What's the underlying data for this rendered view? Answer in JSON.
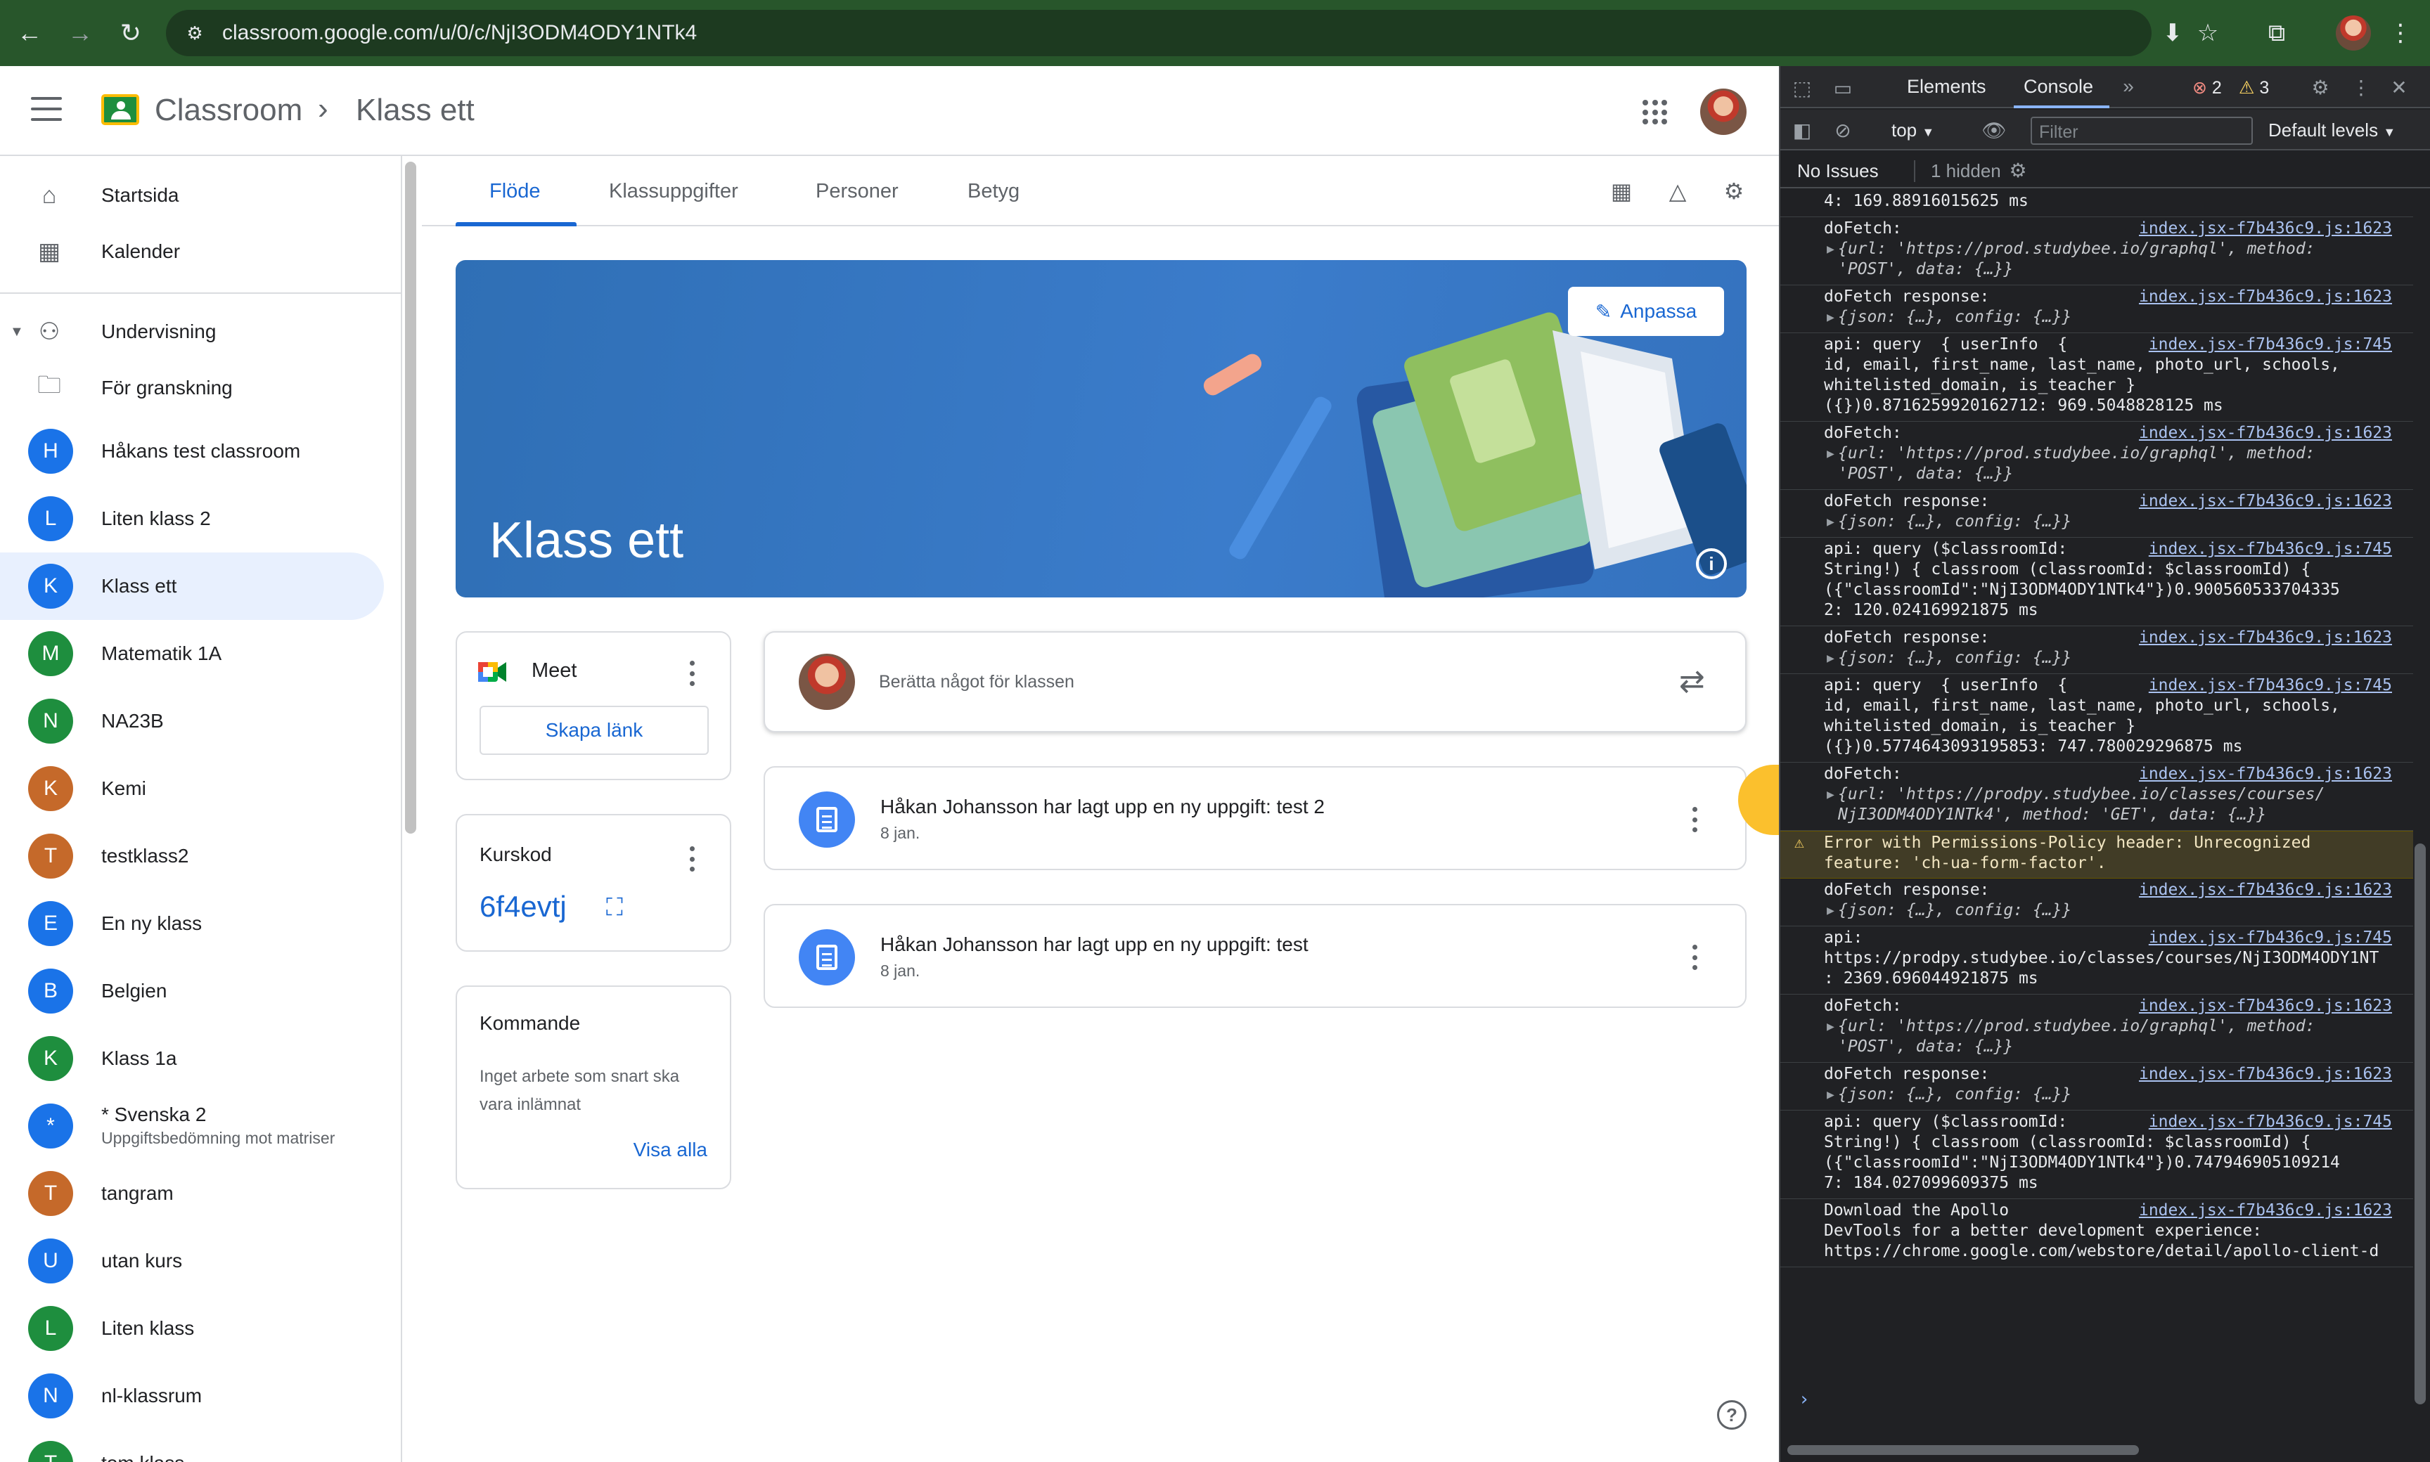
{
  "browser": {
    "url": "classroom.google.com/u/0/c/NjI3ODM4ODY1NTk4",
    "icons": [
      "back-icon",
      "forward-icon",
      "reload-icon",
      "tune-icon",
      "install-icon",
      "star-icon",
      "extensions-icon",
      "avatar",
      "more-icon"
    ]
  },
  "header": {
    "brand": "Classroom",
    "separator": "›",
    "crumb": "Klass ett"
  },
  "sidebar": {
    "home": "Startsida",
    "calendar": "Kalender",
    "teaching": "Undervisning",
    "review": "För granskning",
    "classes": [
      {
        "initial": "H",
        "label": "Håkans test classroom",
        "color": "#1a73e8"
      },
      {
        "initial": "L",
        "label": "Liten klass 2",
        "color": "#1a73e8"
      },
      {
        "initial": "K",
        "label": "Klass ett",
        "color": "#1a73e8",
        "selected": true
      },
      {
        "initial": "M",
        "label": "Matematik 1A",
        "color": "#1e8e3e"
      },
      {
        "initial": "N",
        "label": "NA23B",
        "color": "#1e8e3e"
      },
      {
        "initial": "K",
        "label": "Kemi",
        "color": "#c5692a"
      },
      {
        "initial": "T",
        "label": "testklass2",
        "color": "#c5692a"
      },
      {
        "initial": "E",
        "label": "En ny klass",
        "color": "#1a73e8"
      },
      {
        "initial": "B",
        "label": "Belgien",
        "color": "#1a73e8"
      },
      {
        "initial": "K",
        "label": "Klass 1a",
        "color": "#1e8e3e"
      },
      {
        "initial": "*",
        "label": "* Svenska 2",
        "sub": "Uppgiftsbedömning mot matriser",
        "color": "#1a73e8"
      },
      {
        "initial": "T",
        "label": "tangram",
        "color": "#c5692a"
      },
      {
        "initial": "U",
        "label": "utan kurs",
        "color": "#1a73e8"
      },
      {
        "initial": "L",
        "label": "Liten klass",
        "color": "#1e8e3e"
      },
      {
        "initial": "N",
        "label": "nl-klassrum",
        "color": "#1a73e8"
      },
      {
        "initial": "T",
        "label": "tom klass",
        "color": "#1e8e3e"
      }
    ]
  },
  "tabs": [
    "Flöde",
    "Klassuppgifter",
    "Personer",
    "Betyg"
  ],
  "banner": {
    "title": "Klass ett",
    "customize": "Anpassa"
  },
  "meet": {
    "title": "Meet",
    "create_link": "Skapa länk"
  },
  "course_code": {
    "title": "Kurskod",
    "code": "6f4evtj"
  },
  "upcoming": {
    "title": "Kommande",
    "text": "Inget arbete som snart ska\nvara inlämnat",
    "view_all": "Visa alla"
  },
  "compose": {
    "placeholder": "Berätta något för klassen"
  },
  "posts": [
    {
      "title": "Håkan Johansson har lagt upp en ny uppgift: test 2",
      "date": "8 jan."
    },
    {
      "title": "Håkan Johansson har lagt upp en ny uppgift: test",
      "date": "8 jan."
    }
  ],
  "devtools": {
    "tabs": [
      "Elements",
      "Console"
    ],
    "errors": "2",
    "warnings": "3",
    "context": "top",
    "filter_placeholder": "Filter",
    "levels": "Default levels",
    "no_issues": "No Issues",
    "hidden": "1 hidden",
    "logs": [
      {
        "text": "4: 169.88916015625 ms",
        "src": ""
      },
      {
        "text": "doFetch:",
        "src": "index.jsx-f7b436c9.js:1623",
        "obj": "{url: 'https://prod.studybee.io/graphql', method:\n'POST', data: {…}}"
      },
      {
        "text": "doFetch response:",
        "src": "index.jsx-f7b436c9.js:1623",
        "obj": "{json: {…}, config: {…}}"
      },
      {
        "text": "api: query  { userInfo  {\nid, email, first_name, last_name, photo_url, schools,\nwhitelisted_domain, is_teacher }\n({})0.8716259920162712: 969.5048828125 ms",
        "src": "index.jsx-f7b436c9.js:745"
      },
      {
        "text": "doFetch:",
        "src": "index.jsx-f7b436c9.js:1623",
        "obj": "{url: 'https://prod.studybee.io/graphql', method:\n'POST', data: {…}}"
      },
      {
        "text": "doFetch response:",
        "src": "index.jsx-f7b436c9.js:1623",
        "obj": "{json: {…}, config: {…}}"
      },
      {
        "text": "api: query ($classroomId:\nString!) { classroom (classroomId: $classroomId) {\n({\"classroomId\":\"NjI3ODM4ODY1NTk4\"})0.900560533704335\n2: 120.024169921875 ms",
        "src": "index.jsx-f7b436c9.js:745"
      },
      {
        "text": "doFetch response:",
        "src": "index.jsx-f7b436c9.js:1623",
        "obj": "{json: {…}, config: {…}}"
      },
      {
        "text": "api: query  { userInfo  {\nid, email, first_name, last_name, photo_url, schools,\nwhitelisted_domain, is_teacher }\n({})0.5774643093195853: 747.780029296875 ms",
        "src": "index.jsx-f7b436c9.js:745"
      },
      {
        "text": "doFetch:",
        "src": "index.jsx-f7b436c9.js:1623",
        "obj": "{url: 'https://prodpy.studybee.io/classes/courses/\nNjI3ODM4ODY1NTk4', method: 'GET', data: {…}}"
      },
      {
        "text": "Error with Permissions-Policy header: Unrecognized\nfeature: 'ch-ua-form-factor'.",
        "src": "",
        "warn": true
      },
      {
        "text": "doFetch response:",
        "src": "index.jsx-f7b436c9.js:1623",
        "obj": "{json: {…}, config: {…}}"
      },
      {
        "text": "api:\nhttps://prodpy.studybee.io/classes/courses/NjI3ODM4ODY1NT\n: 2369.696044921875 ms",
        "src": "index.jsx-f7b436c9.js:745"
      },
      {
        "text": "doFetch:",
        "src": "index.jsx-f7b436c9.js:1623",
        "obj": "{url: 'https://prod.studybee.io/graphql', method:\n'POST', data: {…}}"
      },
      {
        "text": "doFetch response:",
        "src": "index.jsx-f7b436c9.js:1623",
        "obj": "{json: {…}, config: {…}}"
      },
      {
        "text": "api: query ($classroomId:\nString!) { classroom (classroomId: $classroomId) {\n({\"classroomId\":\"NjI3ODM4ODY1NTk4\"})0.747946905109214\n7: 184.027099609375 ms",
        "src": "index.jsx-f7b436c9.js:745"
      },
      {
        "text": "Download the Apollo\nDevTools for a better development experience:\nhttps://chrome.google.com/webstore/detail/apollo-client-d",
        "src": "index.jsx-f7b436c9.js:1623"
      }
    ],
    "prompt": "›"
  }
}
